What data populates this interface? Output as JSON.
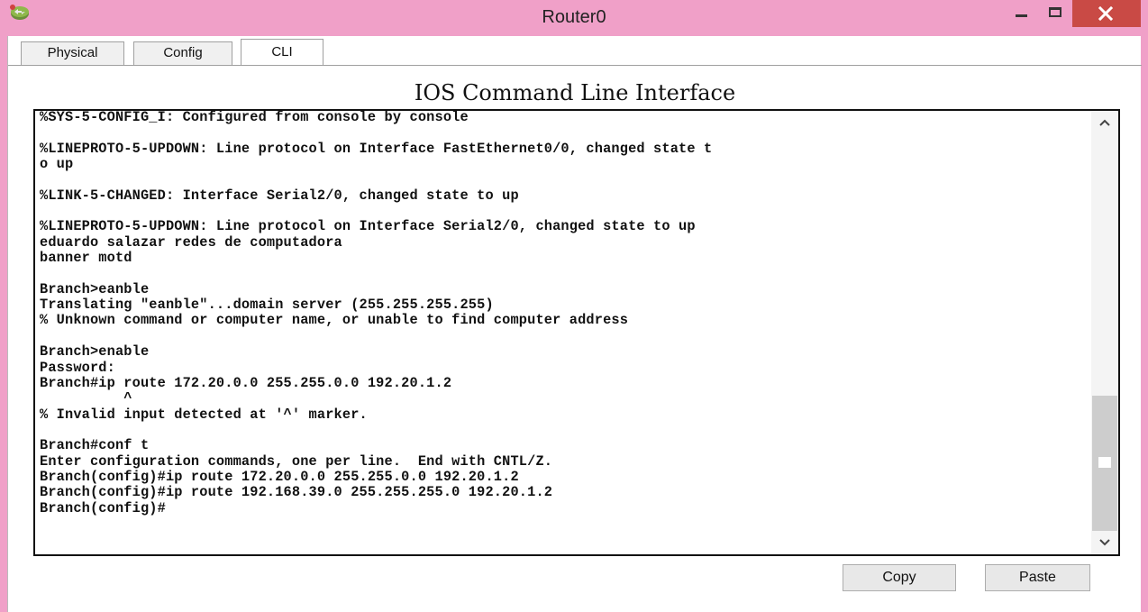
{
  "window": {
    "title": "Router0",
    "icon": "router-app-icon",
    "controls": [
      "minimize-icon",
      "maximize-icon",
      "close-icon"
    ],
    "frame_color": "#f0a0c8",
    "close_color": "#c94a45"
  },
  "tabs": [
    {
      "label": "Physical",
      "active": false
    },
    {
      "label": "Config",
      "active": false
    },
    {
      "label": "CLI",
      "active": true
    }
  ],
  "cli": {
    "heading": "IOS Command Line Interface",
    "lines": [
      "%SYS-5-CONFIG_I: Configured from console by console",
      "",
      "%LINEPROTO-5-UPDOWN: Line protocol on Interface FastEthernet0/0, changed state t",
      "o up",
      "",
      "%LINK-5-CHANGED: Interface Serial2/0, changed state to up",
      "",
      "%LINEPROTO-5-UPDOWN: Line protocol on Interface Serial2/0, changed state to up",
      "eduardo salazar redes de computadora",
      "banner motd",
      "",
      "Branch>eanble",
      "Translating \"eanble\"...domain server (255.255.255.255)",
      "% Unknown command or computer name, or unable to find computer address",
      "",
      "Branch>enable",
      "Password:",
      "Branch#ip route 172.20.0.0 255.255.0.0 192.20.1.2",
      "          ^",
      "% Invalid input detected at '^' marker.",
      "",
      "Branch#conf t",
      "Enter configuration commands, one per line.  End with CNTL/Z.",
      "Branch(config)#ip route 172.20.0.0 255.255.0.0 192.20.1.2",
      "Branch(config)#ip route 192.168.39.0 255.255.255.0 192.20.1.2",
      "Branch(config)#"
    ]
  },
  "buttons": {
    "copy": "Copy",
    "paste": "Paste"
  }
}
